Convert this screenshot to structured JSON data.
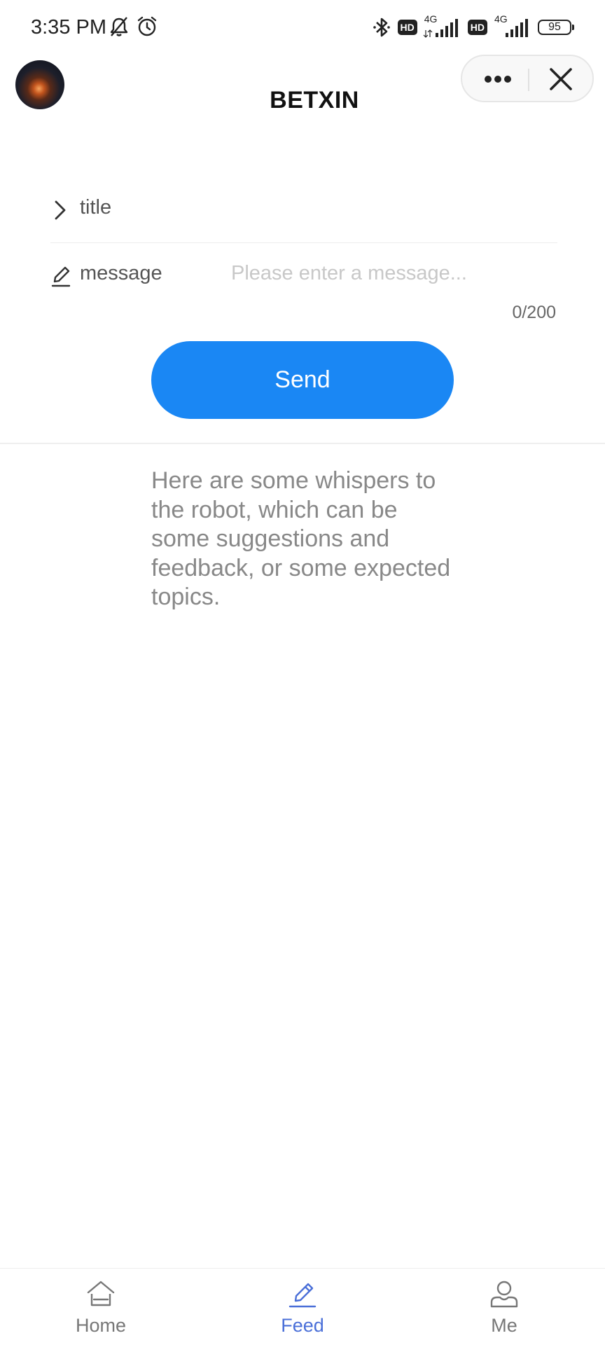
{
  "status_bar": {
    "time": "3:35 PM",
    "network_1": "4G",
    "network_2": "4G",
    "hd_1": "HD",
    "hd_2": "HD",
    "battery": "95"
  },
  "header": {
    "title": "BETXIN"
  },
  "form": {
    "title_label": "title",
    "message_label": "message",
    "message_placeholder": "Please enter a message...",
    "message_value": "",
    "char_count": "0/200",
    "send_label": "Send"
  },
  "description": "Here are some whispers to the robot, which can be some suggestions and feedback, or some expected topics.",
  "tabs": [
    {
      "label": "Home",
      "icon": "home-icon",
      "active": false
    },
    {
      "label": "Feed",
      "icon": "pencil-icon",
      "active": true
    },
    {
      "label": "Me",
      "icon": "user-icon",
      "active": false
    }
  ],
  "colors": {
    "accent": "#1a87f4",
    "active_tab": "#4a6fd8",
    "muted_text": "#888888"
  }
}
